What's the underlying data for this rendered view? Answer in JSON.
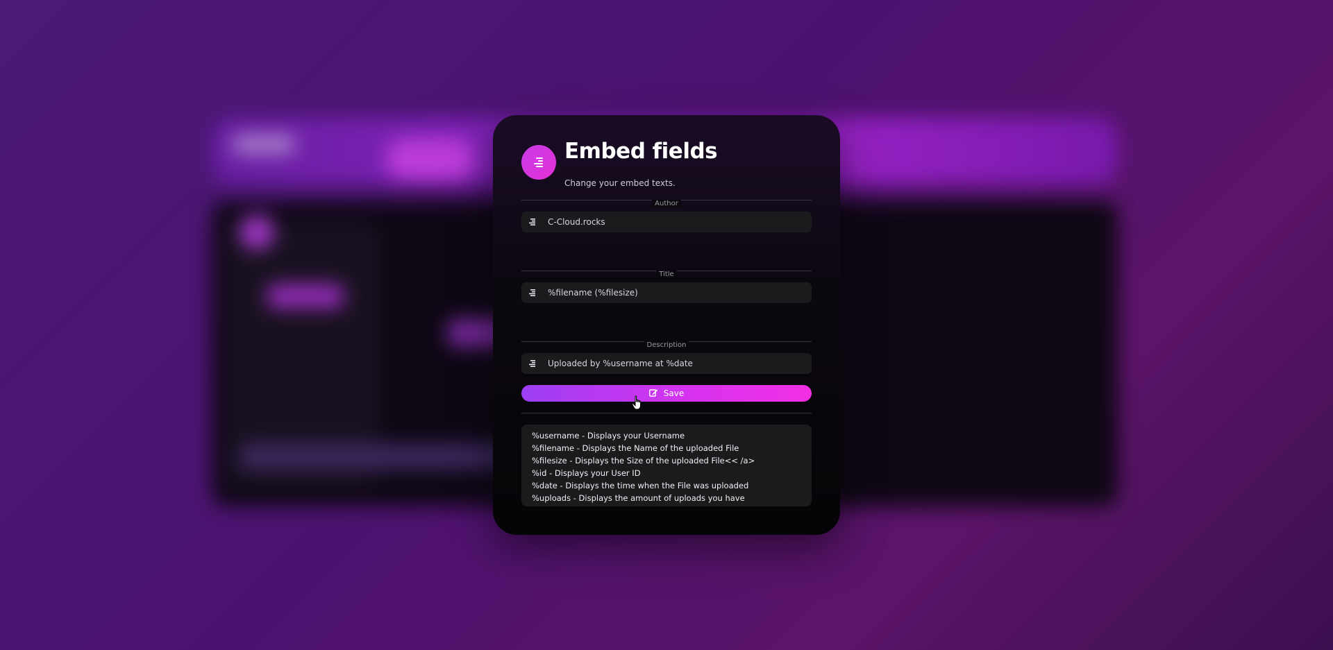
{
  "modal": {
    "title": "Embed fields",
    "subtitle": "Change your embed texts.",
    "header_icon": "align-right-icon"
  },
  "sections": [
    {
      "label": "Author",
      "value": "C-Cloud.rocks",
      "icon": "align-right-icon"
    },
    {
      "label": "Title",
      "value": "%filename (%filesize)",
      "icon": "align-right-icon"
    },
    {
      "label": "Description",
      "value": "Uploaded by %username at %date",
      "icon": "align-right-icon"
    }
  ],
  "save_button": {
    "label": "Save",
    "icon": "edit-icon"
  },
  "placeholders_info": [
    "%username - Displays your Username",
    "%filename - Displays the Name of the uploaded File",
    "%filesize - Displays the Size of the uploaded File<< /a>",
    "%id - Displays your User ID",
    "%date - Displays the time when the File was uploaded",
    "%uploads - Displays the amount of uploads you have"
  ],
  "colors": {
    "accent_start": "#9c3ff2",
    "accent_end": "#f22fe4",
    "modal_bg": "#0c0810",
    "field_bg": "#1b1a1d"
  }
}
